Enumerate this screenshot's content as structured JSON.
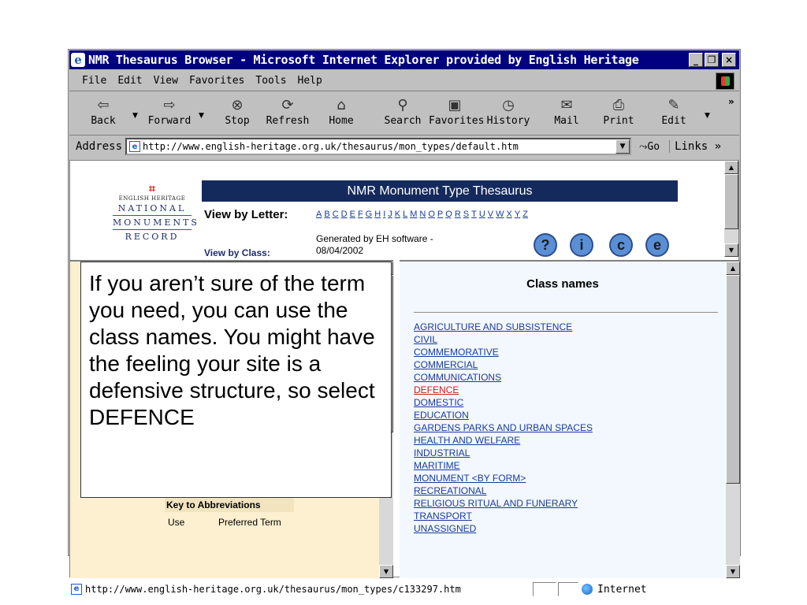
{
  "window": {
    "title": "NMR Thesaurus Browser - Microsoft Internet Explorer provided by English Heritage",
    "minimize": "_",
    "maximize": "❐",
    "close": "×"
  },
  "menu": [
    "File",
    "Edit",
    "View",
    "Favorites",
    "Tools",
    "Help"
  ],
  "toolbar": {
    "back": "Back",
    "forward": "Forward",
    "stop": "Stop",
    "refresh": "Refresh",
    "home": "Home",
    "search": "Search",
    "favorites": "Favorites",
    "history": "History",
    "mail": "Mail",
    "print": "Print",
    "edit": "Edit",
    "more": "»"
  },
  "address": {
    "label": "Address",
    "url": "http://www.english-heritage.org.uk/thesaurus/mon_types/default.htm",
    "go": "Go",
    "links": "Links »"
  },
  "header": {
    "logo_small": "ENGLISH HERITAGE",
    "logo_line1": "NATIONAL",
    "logo_line2": "MONUMENTS",
    "logo_line3": "RECORD",
    "banner": "NMR Monument Type Thesaurus",
    "view_by_letter": "View by Letter:",
    "letters": [
      "A",
      "B",
      "C",
      "D",
      "E",
      "F",
      "G",
      "H",
      "I",
      "J",
      "K",
      "L",
      "M",
      "N",
      "O",
      "P",
      "Q",
      "R",
      "S",
      "T",
      "U",
      "V",
      "W",
      "X",
      "Y",
      "Z"
    ],
    "view_by_class": "View by Class:",
    "generated": "Generated by EH software - 08/04/2002",
    "icons": [
      "?",
      "i",
      "c",
      "e"
    ]
  },
  "left_frame": {
    "key_heading": "Key to Abbreviations",
    "key_col1": "Use",
    "key_col2": "Preferred Term"
  },
  "class_names": {
    "heading": "Class names",
    "items": [
      "AGRICULTURE AND SUBSISTENCE",
      "CIVIL",
      "COMMEMORATIVE",
      "COMMERCIAL",
      "COMMUNICATIONS",
      "DEFENCE",
      "DOMESTIC",
      "EDUCATION",
      "GARDENS PARKS AND URBAN SPACES",
      "HEALTH AND WELFARE",
      "INDUSTRIAL",
      "MARITIME",
      "MONUMENT <BY FORM>",
      "RECREATIONAL",
      "RELIGIOUS RITUAL AND FUNERARY",
      "TRANSPORT",
      "UNASSIGNED"
    ],
    "selected": "DEFENCE"
  },
  "callout": {
    "text": "If you aren’t sure of the term you need, you can use the class names. You might have the feeling your site is a defensive structure, so select DEFENCE"
  },
  "status": {
    "url": "http://www.english-heritage.org.uk/thesaurus/mon_types/c133297.htm",
    "zone": "Internet"
  }
}
